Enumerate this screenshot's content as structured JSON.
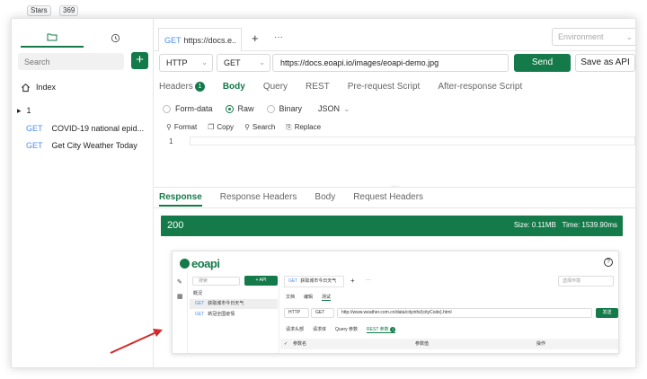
{
  "github": {
    "stars_label": "Stars",
    "stars_count": "369"
  },
  "colors": {
    "accent": "#157a4a",
    "method_get": "#4d8ef0",
    "annotation_arrow": "#d62a2a"
  },
  "sidebar": {
    "tabs": [
      {
        "icon": "folder-icon",
        "active": true
      },
      {
        "icon": "history-icon",
        "active": false
      }
    ],
    "search_placeholder": "Search",
    "add_label": "+",
    "index_label": "Index",
    "tree_toggle": "▸",
    "tree_label": "1",
    "apis": [
      {
        "method": "GET",
        "name": "COVID-19 national epid..."
      },
      {
        "method": "GET",
        "name": "Get City Weather Today"
      }
    ]
  },
  "tabbar": {
    "tab_method": "GET",
    "tab_title": "https://docs.e..",
    "plus": "+",
    "more": "···",
    "environment_placeholder": "Environment"
  },
  "request": {
    "protocol": "HTTP",
    "method": "GET",
    "url": "https://docs.eoapi.io/images/eoapi-demo.jpg",
    "send_label": "Send",
    "save_label": "Save as API"
  },
  "request_tabs": {
    "headers": "Headers",
    "headers_count": "1",
    "body": "Body",
    "query": "Query",
    "rest": "REST",
    "pre_script": "Pre-request Script",
    "post_script": "After-response Script"
  },
  "body_options": {
    "form_data": "Form-data",
    "raw": "Raw",
    "binary": "Binary",
    "format": "JSON",
    "selected": "Raw"
  },
  "editor_toolbar": {
    "format": "Format",
    "copy": "Copy",
    "search": "Search",
    "replace": "Replace"
  },
  "editor": {
    "line_number": "1"
  },
  "response_tabs": {
    "response": "Response",
    "response_headers": "Response Headers",
    "body": "Body",
    "request_headers": "Request Headers"
  },
  "response_status": {
    "code": "200",
    "size": "Size: 0.11MB",
    "time": "Time: 1539.90ms"
  },
  "preview": {
    "logo_text": "eoapi",
    "help": "?",
    "search_placeholder": "搜索",
    "add_api": "+ API",
    "overview": "概況",
    "items": [
      {
        "method": "GET",
        "name": "获取城市今日天气"
      },
      {
        "method": "GET",
        "name": "新冠全国疫情"
      }
    ],
    "tab_method": "GET",
    "tab_title": "获取城市今日天气",
    "plus": "+",
    "more": "···",
    "env_placeholder": "选择环境",
    "subtabs": [
      "文档",
      "编辑",
      "测试"
    ],
    "protocol": "HTTP",
    "method": "GET",
    "url": "http://www.weather.com.cn/data/cityinfo/{cityCode}.html",
    "send": "发送",
    "param_tabs": [
      "请求头部",
      "请求体",
      "Query 参数",
      "REST 参数"
    ],
    "rest_count": "1",
    "col_name": "参数名",
    "col_value": "参数值",
    "col_action": "操作"
  }
}
